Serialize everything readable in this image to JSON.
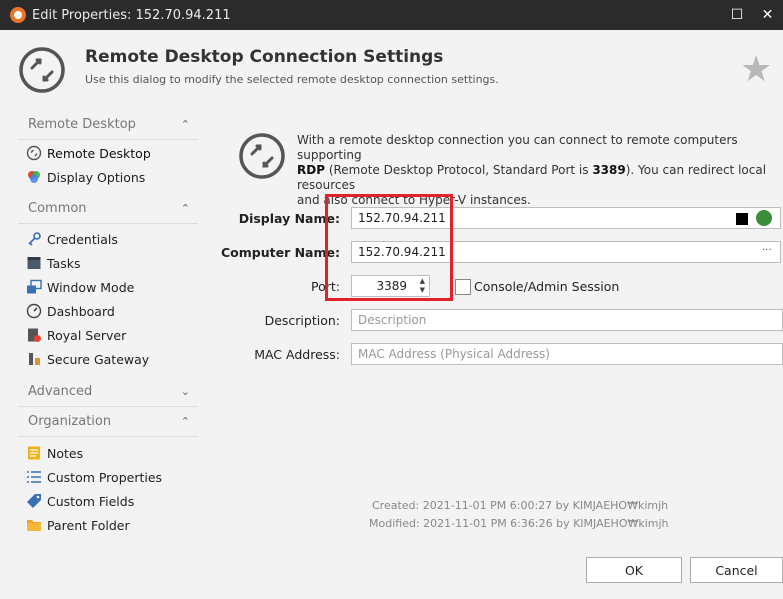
{
  "window": {
    "title": "Edit Properties: 152.70.94.211",
    "maximize_glyph": "☐",
    "close_glyph": "✕"
  },
  "header": {
    "title": "Remote Desktop Connection Settings",
    "subtitle": "Use this dialog to modify the selected remote desktop connection settings.",
    "star_glyph": "★"
  },
  "sidebar": {
    "sections": [
      {
        "label": "Remote Desktop",
        "chevron": "⌃",
        "items": [
          {
            "label": "Remote Desktop",
            "icon": "rdp-icon"
          },
          {
            "label": "Display Options",
            "icon": "display-options-icon"
          }
        ]
      },
      {
        "label": "Common",
        "chevron": "⌃",
        "items": [
          {
            "label": "Credentials",
            "icon": "key-icon"
          },
          {
            "label": "Tasks",
            "icon": "tasks-icon"
          },
          {
            "label": "Window Mode",
            "icon": "window-mode-icon"
          },
          {
            "label": "Dashboard",
            "icon": "dashboard-icon"
          },
          {
            "label": "Royal Server",
            "icon": "royal-server-icon"
          },
          {
            "label": "Secure Gateway",
            "icon": "secure-gateway-icon"
          }
        ]
      },
      {
        "label": "Advanced",
        "chevron": "⌄",
        "items": []
      },
      {
        "label": "Organization",
        "chevron": "⌃",
        "items": [
          {
            "label": "Notes",
            "icon": "notes-icon"
          },
          {
            "label": "Custom Properties",
            "icon": "list-icon"
          },
          {
            "label": "Custom Fields",
            "icon": "tag-icon"
          },
          {
            "label": "Parent Folder",
            "icon": "folder-icon"
          }
        ]
      }
    ]
  },
  "info": {
    "line1": "With a remote desktop connection you can connect to remote computers supporting",
    "rdp_bold": "RDP",
    "line2_mid": " (Remote Desktop Protocol, Standard Port is ",
    "port_bold": "3389",
    "line2_end": "). You can redirect local resources",
    "line3": "and also connect to Hyper-V instances."
  },
  "form": {
    "display_name_label": "Display Name:",
    "display_name_value": "152.70.94.211",
    "computer_name_label": "Computer Name:",
    "computer_name_value": "152.70.94.211",
    "browse_glyph": "···",
    "port_label": "Port:",
    "port_value": "3389",
    "console_label": "Console/Admin Session",
    "description_label": "Description:",
    "description_placeholder": "Description",
    "mac_label": "MAC Address:",
    "mac_placeholder": "MAC Address (Physical Address)"
  },
  "meta": {
    "created": "Created: 2021-11-01 PM 6:00:27 by KIMJAEHO₩kimjh",
    "modified": "Modified: 2021-11-01 PM 6:36:26 by KIMJAEHO₩kimjh"
  },
  "buttons": {
    "ok": "OK",
    "cancel": "Cancel"
  },
  "colors": {
    "highlight_box": "#e3212b",
    "titlebar": "#2b2b2b",
    "app_icon": "#e8742a"
  }
}
